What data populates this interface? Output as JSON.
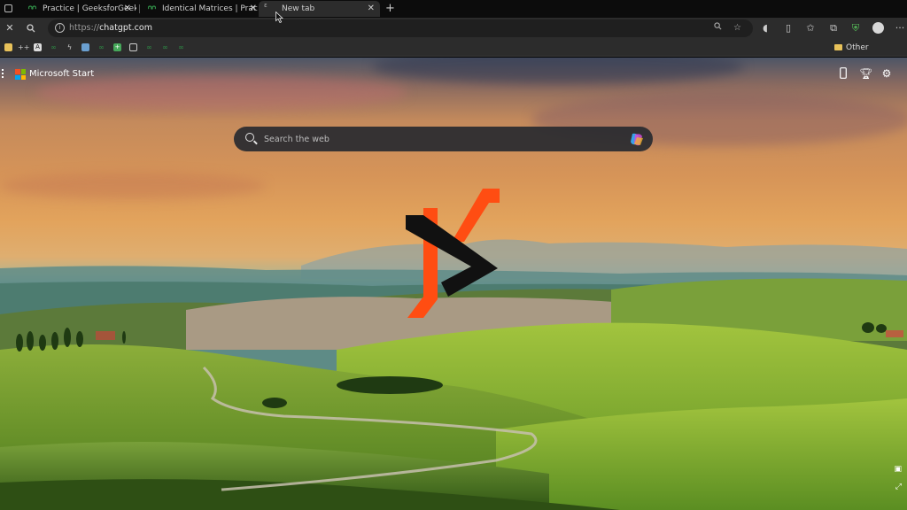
{
  "tabs": [
    {
      "title": "Practice | GeeksforGeek",
      "active": false,
      "favicon": "gfg-icon"
    },
    {
      "title": "Identical Matrices | Prac",
      "active": false,
      "favicon": "gfg-icon"
    },
    {
      "title": "New tab",
      "active": true,
      "favicon": "edge-icon"
    }
  ],
  "toolbar": {
    "url_protocol": "https://",
    "url_host": "chatgpt.com"
  },
  "favorites": {
    "other_label": "Other favourites"
  },
  "page": {
    "brand": "Microsoft Start",
    "search_placeholder": "Search the web"
  },
  "colors": {
    "accent_orange": "#ff4d12",
    "gfg_green": "#2f8d46"
  }
}
